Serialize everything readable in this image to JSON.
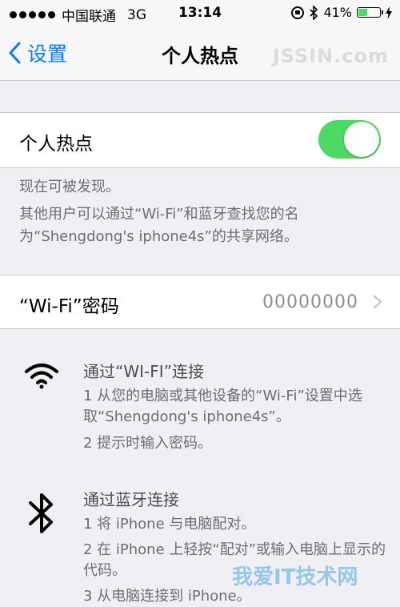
{
  "status_bar": {
    "carrier": "中国联通",
    "network": "3G",
    "time": "13:14",
    "battery_text": "41%",
    "battery_level": 0.41
  },
  "nav": {
    "back_label": "设置",
    "title": "个人热点",
    "watermark": "JSSIN.com"
  },
  "hotspot": {
    "label": "个人热点",
    "enabled": true,
    "discoverable_text": "现在可被发现。",
    "description": "其他用户可以通过“Wi-Fi”和蓝牙查找您的名为“Shengdong's iphone4s”的共享网络。"
  },
  "wifi_password": {
    "label": "“Wi-Fi”密码",
    "value": "00000000"
  },
  "wifi_section": {
    "title": "通过“WI-FI”连接",
    "steps": [
      "1 从您的电脑或其他设备的“Wi-Fi”设置中选取“Shengdong's iphone4s”。",
      "2 提示时输入密码。"
    ]
  },
  "bt_section": {
    "title": "通过蓝牙连接",
    "steps": [
      "1 将 iPhone 与电脑配对。",
      "2 在 iPhone 上轻按“配对”或输入电脑上显示的代码。",
      "3 从电脑连接到 iPhone。"
    ]
  },
  "watermark_bottom": "我爱IT技术网",
  "colors": {
    "accent": "#0a7aff",
    "toggle_on": "#4cd964",
    "background": "#efeff4"
  },
  "icons": [
    "signal-dots-icon",
    "rotation-lock-icon",
    "bluetooth-icon",
    "battery-icon",
    "charging-icon",
    "back-chevron-icon",
    "chevron-right-icon",
    "wifi-icon"
  ]
}
